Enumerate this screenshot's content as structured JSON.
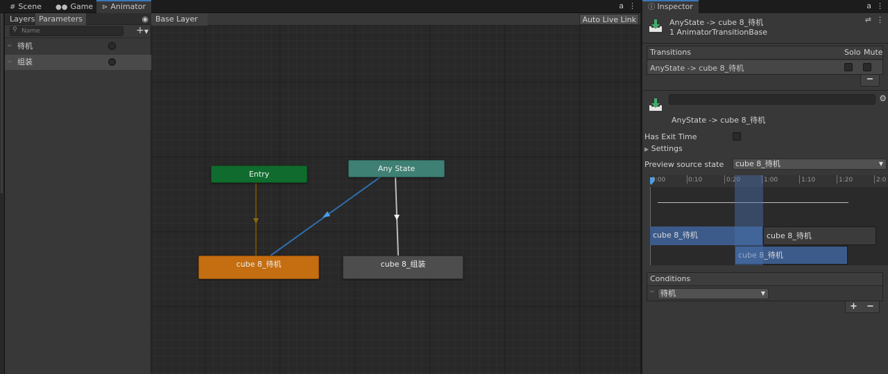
{
  "window_tabs": [
    {
      "label": "Scene",
      "icon": "grid-icon"
    },
    {
      "label": "Game",
      "icon": "gamepad-icon"
    },
    {
      "label": "Animator",
      "icon": "animator-icon"
    }
  ],
  "panel": {
    "tabs": [
      "Layers",
      "Parameters"
    ],
    "search_placeholder": "Name",
    "parameters": [
      {
        "name": "待机",
        "type": "trigger"
      },
      {
        "name": "组装",
        "type": "trigger"
      }
    ]
  },
  "graph": {
    "breadcrumb": "Base Layer",
    "live_link_button": "Auto Live Link",
    "states": {
      "entry": "Entry",
      "any_state": "Any State",
      "idle": "cube 8_待机",
      "assemble": "cube 8_组装"
    },
    "colors": {
      "entry": "#106c2e",
      "any_state": "#3e8073",
      "default_state": "#c46d11",
      "state": "#4d4d4d",
      "selected_transition": "#4a9fe8"
    }
  },
  "inspector": {
    "tab_label": "Inspector",
    "header_title": "AnyState -> cube 8_待机",
    "header_subtitle": "1 AnimatorTransitionBase",
    "transitions": {
      "title": "Transitions",
      "solo_label": "Solo",
      "mute_label": "Mute",
      "rows": [
        {
          "label": "AnyState -> cube 8_待机",
          "solo": false,
          "mute": false
        }
      ],
      "remove_label": "−"
    },
    "transition_name_value": "",
    "transition_subtitle": "AnyState -> cube 8_待机",
    "has_exit_time_label": "Has Exit Time",
    "has_exit_time": false,
    "settings_label": "Settings",
    "preview_source_label": "Preview source state",
    "preview_source_value": "cube 8_待机",
    "timeline": {
      "ticks": [
        "0:00",
        "0:10",
        "0:20",
        "1:00",
        "1:10",
        "1:20",
        "2:0"
      ],
      "source_clip": "cube 8_待机",
      "source_clip_next": "cube 8_待机",
      "destination_clip": "cube 8_待机"
    },
    "conditions": {
      "title": "Conditions",
      "rows": [
        {
          "parameter": "待机"
        }
      ],
      "add_label": "+",
      "remove_label": "−"
    }
  }
}
